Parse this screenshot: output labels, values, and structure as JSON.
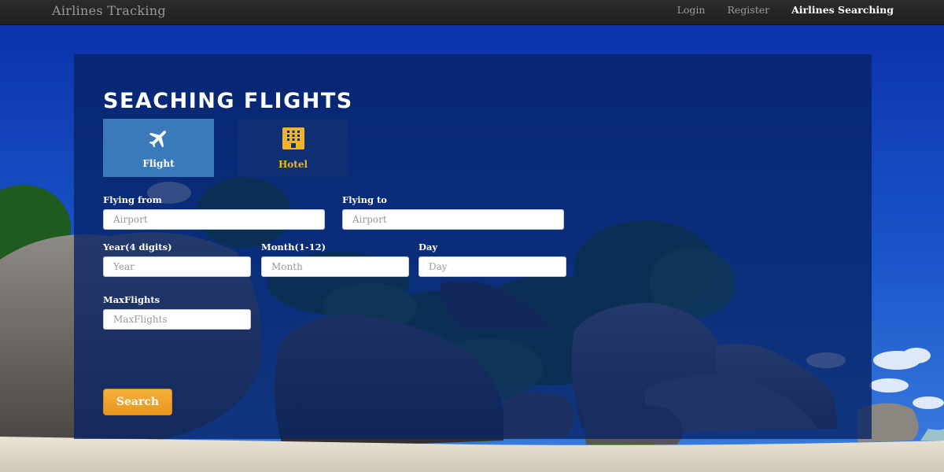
{
  "navbar": {
    "brand": "Airlines Tracking",
    "links": [
      "Login",
      "Register",
      "Airlines Searching"
    ]
  },
  "page": {
    "title": "SEACHING FLIGHTS"
  },
  "tabs": [
    {
      "label": "Flight",
      "icon": "airplane-icon"
    },
    {
      "label": "Hotel",
      "icon": "hotel-icon"
    }
  ],
  "form": {
    "flying_from": {
      "label": "Flying from",
      "placeholder": "Airport",
      "value": ""
    },
    "flying_to": {
      "label": "Flying to",
      "placeholder": "Airport",
      "value": ""
    },
    "year": {
      "label": "Year(4 digits)",
      "placeholder": "Year",
      "value": ""
    },
    "month": {
      "label": "Month(1-12)",
      "placeholder": "Month",
      "value": ""
    },
    "day": {
      "label": "Day",
      "placeholder": "Day",
      "value": ""
    },
    "max_flights": {
      "label": "MaxFlights",
      "placeholder": "MaxFlights",
      "value": ""
    },
    "search_label": "Search"
  },
  "colors": {
    "navbar": "#222222",
    "panel": "#062264",
    "tab_active": "#3a7ab8",
    "tab_inactive": "#0e2f74",
    "hotel_accent": "#f3b32a",
    "search_button": "#f0a42c"
  }
}
